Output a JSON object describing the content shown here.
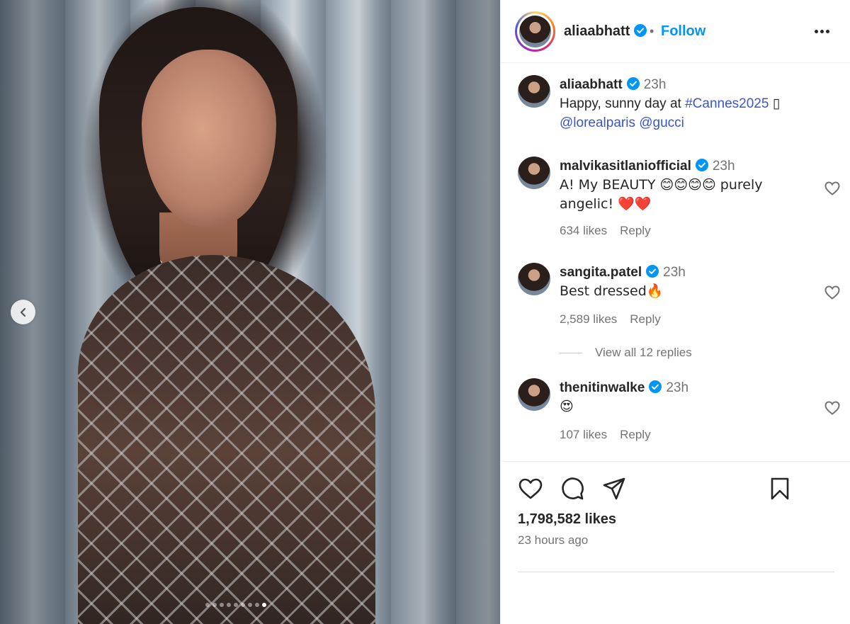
{
  "post": {
    "image_alt": "",
    "carousel": {
      "count": 9,
      "active_index": 8
    }
  },
  "header": {
    "username": "aliaabhatt",
    "separator": "•",
    "follow_label": "Follow"
  },
  "caption": {
    "username": "aliaabhatt",
    "time": "23h",
    "text_prefix": "Happy, sunny day at ",
    "hashtag": "#Cannes2025",
    "text_suffix": " ▯",
    "mention1": "@lorealparis",
    "mention2": "@gucci"
  },
  "comments": [
    {
      "username": "malvikasitlaniofficial",
      "time": "23h",
      "text": "A! My BEAUTY 😊😊😊😊 purely angelic! ❤️❤️",
      "likes": "634 likes",
      "reply": "Reply"
    },
    {
      "username": "sangita.patel",
      "time": "23h",
      "text": "Best dressed🔥",
      "likes": "2,589 likes",
      "reply": "Reply"
    },
    {
      "username": "thenitinwalke",
      "time": "23h",
      "text": "😍",
      "likes": "107 likes",
      "reply": "Reply"
    }
  ],
  "view_replies": "View all 12 replies",
  "stats": {
    "likes": "1,798,582 likes",
    "posted": "23 hours ago"
  },
  "icons": {
    "verified": "verified-badge-icon",
    "heart": "heart-icon",
    "comment": "comment-icon",
    "share": "share-icon",
    "save": "bookmark-icon",
    "more": "more-horizontal-icon",
    "prev": "chevron-left-icon"
  },
  "colors": {
    "accent": "#0095f6",
    "text": "#262626",
    "muted": "#737373",
    "tag": "#3a55c7"
  }
}
